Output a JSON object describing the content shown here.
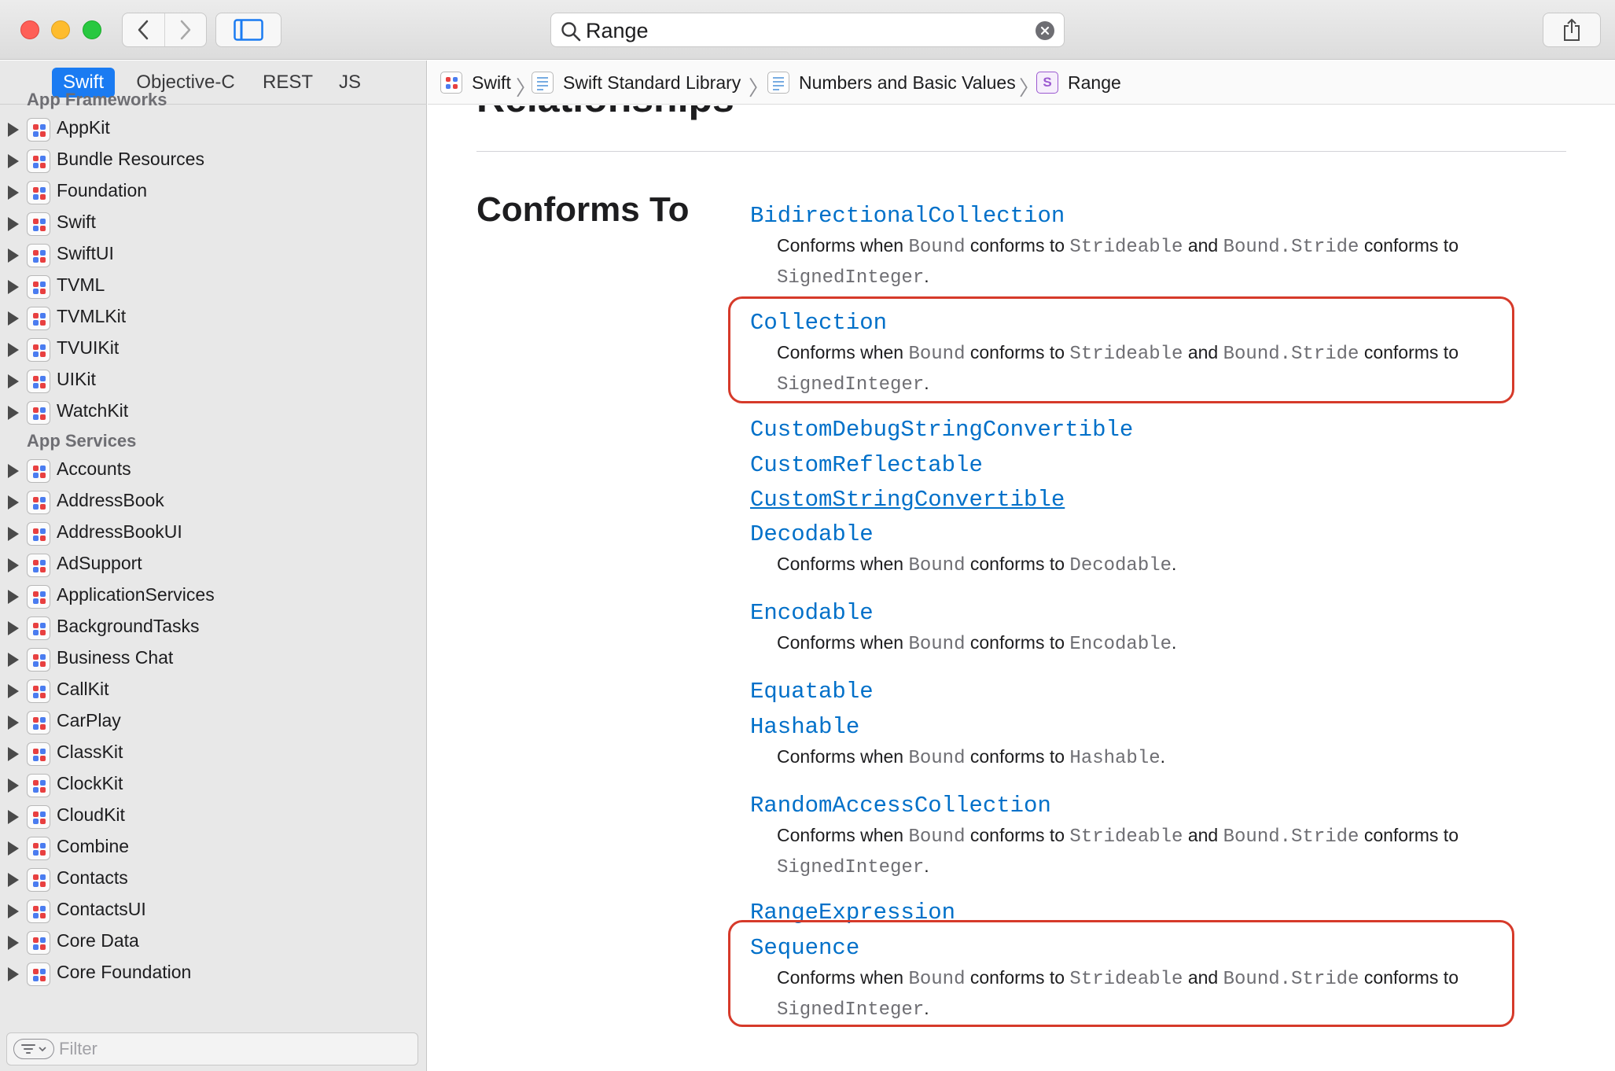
{
  "toolbar": {
    "back_icon": "chevron-left-icon",
    "forward_icon": "chevron-right-icon",
    "sidebar_icon": "sidebar-toggle-icon",
    "share_icon": "share-icon"
  },
  "search": {
    "value": "Range",
    "clear_icon": "clear-icon"
  },
  "sidebar": {
    "language_tabs": [
      "Swift",
      "Objective-C",
      "REST",
      "JS"
    ],
    "active_tab": "Swift",
    "sections": [
      {
        "header": "App Frameworks",
        "items": [
          "AppKit",
          "Bundle Resources",
          "Foundation",
          "Swift",
          "SwiftUI",
          "TVML",
          "TVMLKit",
          "TVUIKit",
          "UIKit",
          "WatchKit"
        ]
      },
      {
        "header": "App Services",
        "items": [
          "Accounts",
          "AddressBook",
          "AddressBookUI",
          "AdSupport",
          "ApplicationServices",
          "BackgroundTasks",
          "Business Chat",
          "CallKit",
          "CarPlay",
          "ClassKit",
          "ClockKit",
          "CloudKit",
          "Combine",
          "Contacts",
          "ContactsUI",
          "Core Data",
          "Core Foundation"
        ]
      }
    ],
    "filter_placeholder": "Filter"
  },
  "breadcrumb": [
    {
      "label": "Swift",
      "icon": "framework-icon"
    },
    {
      "label": "Swift Standard Library",
      "icon": "collection-icon"
    },
    {
      "label": "Numbers and Basic Values",
      "icon": "collection-icon"
    },
    {
      "label": "Range",
      "icon": "structure-icon",
      "icon_letter": "S"
    }
  ],
  "content": {
    "section_title": "Relationships",
    "conforms_heading": "Conforms To",
    "protocols": [
      {
        "name": "BidirectionalCollection",
        "desc": "stride"
      },
      {
        "name": "Collection",
        "desc": "stride",
        "highlighted": true
      },
      {
        "name": "CustomDebugStringConvertible"
      },
      {
        "name": "CustomReflectable"
      },
      {
        "name": "CustomStringConvertible",
        "underlined": true
      },
      {
        "name": "Decodable",
        "desc": "simple",
        "target": "Decodable"
      },
      {
        "name": "Encodable",
        "desc": "simple",
        "target": "Encodable"
      },
      {
        "name": "Equatable"
      },
      {
        "name": "Hashable",
        "desc": "simple",
        "target": "Hashable"
      },
      {
        "name": "RandomAccessCollection",
        "desc": "stride"
      },
      {
        "name": "RangeExpression"
      },
      {
        "name": "Sequence",
        "desc": "stride",
        "highlighted": true
      }
    ],
    "desc_text": {
      "conforms_when": "Conforms when",
      "bound": "Bound",
      "conforms_to": "conforms to",
      "strideable": "Strideable",
      "and": "and",
      "bound_stride": "Bound.Stride",
      "signed_integer": "SignedInteger",
      "period": "."
    }
  },
  "colors": {
    "link": "#0070c9",
    "accent": "#1a7bf2",
    "highlight_box": "#d63a2a"
  }
}
